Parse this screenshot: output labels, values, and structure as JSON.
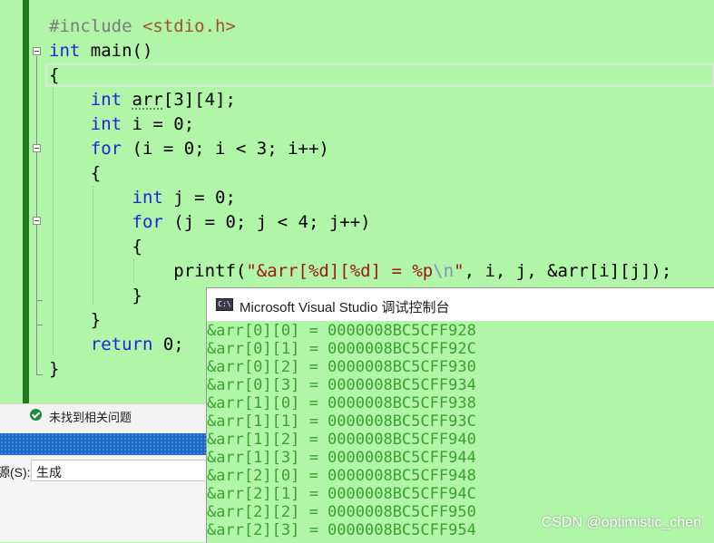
{
  "editor": {
    "lines": [
      {
        "id": "l1",
        "parts": [
          {
            "t": "#include ",
            "c": "pp"
          },
          {
            "t": "<stdio.h>",
            "c": "inc"
          }
        ]
      },
      {
        "id": "l2",
        "parts": [
          {
            "t": "int",
            "c": "kw"
          },
          {
            "t": " main()",
            "c": ""
          }
        ]
      },
      {
        "id": "l3",
        "parts": [
          {
            "t": "{",
            "c": ""
          }
        ]
      },
      {
        "id": "l4",
        "parts": [
          {
            "t": "    ",
            "c": ""
          },
          {
            "t": "int",
            "c": "kw"
          },
          {
            "t": " ",
            "c": ""
          },
          {
            "t": "arr",
            "c": "squig"
          },
          {
            "t": "[3][4];",
            "c": ""
          }
        ]
      },
      {
        "id": "l5",
        "parts": [
          {
            "t": "    ",
            "c": ""
          },
          {
            "t": "int",
            "c": "kw"
          },
          {
            "t": " i = 0;",
            "c": ""
          }
        ]
      },
      {
        "id": "l6",
        "parts": [
          {
            "t": "    ",
            "c": ""
          },
          {
            "t": "for",
            "c": "kw"
          },
          {
            "t": " (i = 0; i < 3; i++)",
            "c": ""
          }
        ]
      },
      {
        "id": "l7",
        "parts": [
          {
            "t": "    {",
            "c": ""
          }
        ]
      },
      {
        "id": "l8",
        "parts": [
          {
            "t": "        ",
            "c": ""
          },
          {
            "t": "int",
            "c": "kw"
          },
          {
            "t": " j = 0;",
            "c": ""
          }
        ]
      },
      {
        "id": "l9",
        "parts": [
          {
            "t": "        ",
            "c": ""
          },
          {
            "t": "for",
            "c": "kw"
          },
          {
            "t": " (j = 0; j < 4; j++)",
            "c": ""
          }
        ]
      },
      {
        "id": "l10",
        "parts": [
          {
            "t": "        {",
            "c": ""
          }
        ]
      },
      {
        "id": "l11",
        "parts": [
          {
            "t": "            printf(",
            "c": ""
          },
          {
            "t": "\"&arr[%d][%d] = %p",
            "c": "str"
          },
          {
            "t": "\\n",
            "c": "esc"
          },
          {
            "t": "\"",
            "c": "str"
          },
          {
            "t": ", i, j, &arr[i][j]);",
            "c": ""
          }
        ]
      },
      {
        "id": "l12",
        "parts": [
          {
            "t": "        }",
            "c": ""
          }
        ]
      },
      {
        "id": "l13",
        "parts": [
          {
            "t": "    }",
            "c": ""
          }
        ]
      },
      {
        "id": "l14",
        "parts": [
          {
            "t": "    ",
            "c": ""
          },
          {
            "t": "return",
            "c": "kw"
          },
          {
            "t": " 0;",
            "c": ""
          }
        ]
      },
      {
        "id": "l15",
        "parts": [
          {
            "t": "}",
            "c": ""
          }
        ]
      }
    ]
  },
  "issues": {
    "text": "未找到相关问题"
  },
  "output": {
    "label": "源(S):",
    "source": "生成"
  },
  "console": {
    "icon_text": "C:\\",
    "title": "Microsoft Visual Studio 调试控制台",
    "lines": [
      "&arr[0][0] = 0000008BC5CFF928",
      "&arr[0][1] = 0000008BC5CFF92C",
      "&arr[0][2] = 0000008BC5CFF930",
      "&arr[0][3] = 0000008BC5CFF934",
      "&arr[1][0] = 0000008BC5CFF938",
      "&arr[1][1] = 0000008BC5CFF93C",
      "&arr[1][2] = 0000008BC5CFF940",
      "&arr[1][3] = 0000008BC5CFF944",
      "&arr[2][0] = 0000008BC5CFF948",
      "&arr[2][1] = 0000008BC5CFF94C",
      "&arr[2][2] = 0000008BC5CFF950",
      "&arr[2][3] = 0000008BC5CFF954"
    ]
  },
  "watermark": "CSDN @optimistic_chen",
  "colors": {
    "editor_bg": "#b0f5a8",
    "keyword": "#2222dd",
    "console_text": "#3aa12e",
    "change_bar": "#1f7d1f",
    "accent_blue": "#1b68c6"
  }
}
